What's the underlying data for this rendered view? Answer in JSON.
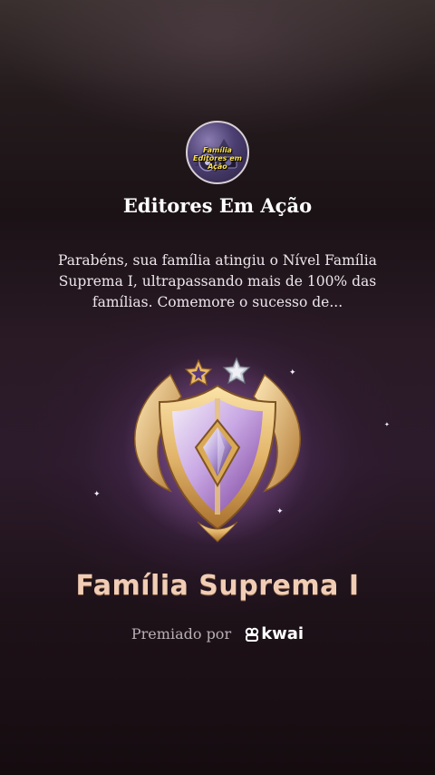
{
  "family": {
    "avatar_text": "Família Editores em Ação",
    "name": "Editores Em Ação"
  },
  "message": "Parabéns, sua família atingiu o Nível Família Suprema I, ultrapassando mais de 100% das famílias. Comemore o sucesso de...",
  "badge": {
    "stars_filled": 2,
    "icon": "shield-crest-icon"
  },
  "level": {
    "name": "Família Suprema I"
  },
  "awarded": {
    "label": "Premiado por",
    "brand": "kwai"
  },
  "colors": {
    "level_text": "#f0cdb4",
    "gold": "#e2b46a",
    "background": "#1b1216"
  }
}
